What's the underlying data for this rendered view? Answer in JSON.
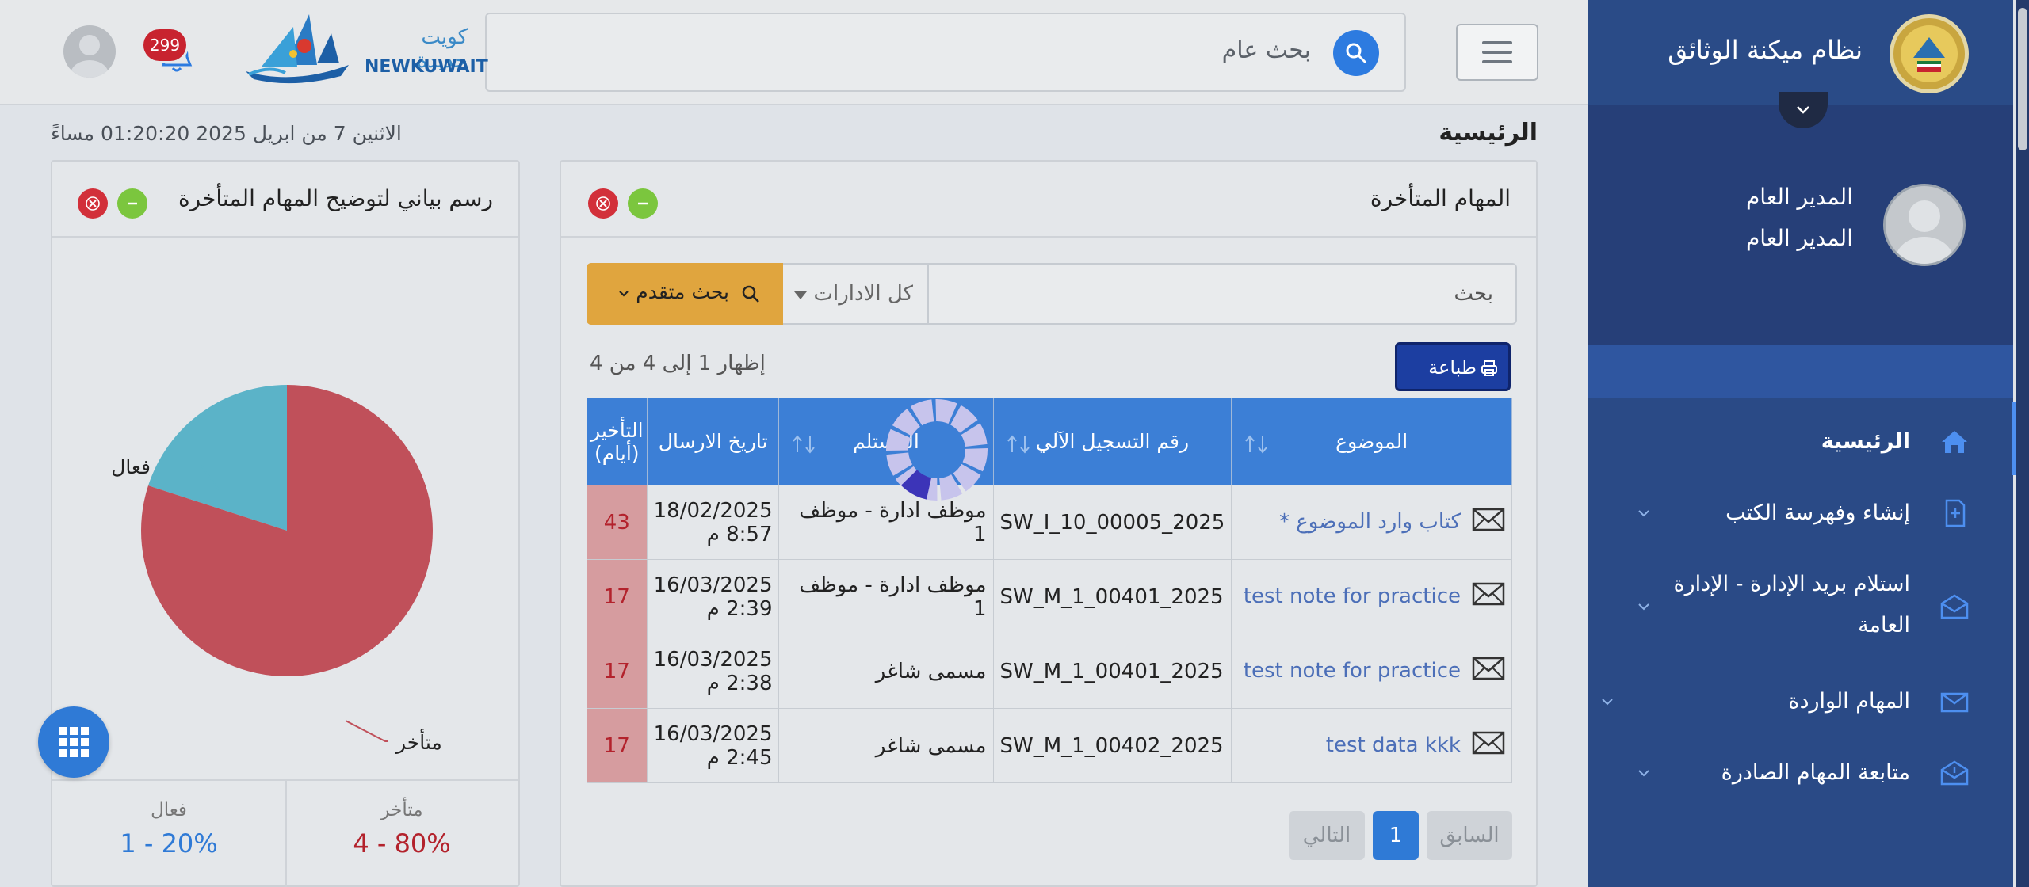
{
  "header": {
    "search_label": "بحث عام",
    "notification_count": "299",
    "logo_ar": "كويت جديدة",
    "logo_en": "NEWKUWAIT"
  },
  "sidebar": {
    "title": "نظام ميكنة الوثائق",
    "user_name": "المدير العام",
    "user_role": "المدير العام",
    "items": [
      {
        "label": "الرئيسية",
        "icon": "home-icon",
        "active": true
      },
      {
        "label": "إنشاء وفهرسة الكتب",
        "icon": "file-plus-icon"
      },
      {
        "label": "استلام بريد الإدارة - الإدارة العامة",
        "icon": "envelope-open-icon"
      },
      {
        "label": "المهام الواردة",
        "icon": "envelope-icon"
      },
      {
        "label": "متابعة المهام الصادرة",
        "icon": "envelope-share-icon"
      }
    ]
  },
  "main": {
    "date_line": "الاثنين 7 من ابريل 2025   01:20:20 مساءً",
    "page_title": "الرئيسية"
  },
  "tasks_panel": {
    "title": "المهام المتأخرة",
    "search_placeholder": "بحث",
    "dept_select": "كل الادارات",
    "advanced_search": "بحث متقدم",
    "print": "طباعة",
    "showing": "إظهار 1 إلى 4 من 4",
    "columns": [
      "الموضوع",
      "رقم التسجيل الآلي",
      "المستلم",
      "تاريخ الارسال",
      "التأخير (أيام)"
    ],
    "rows": [
      {
        "subject": "كتاب وارد الموضوع *",
        "reg_no": "SW_I_10_00005_2025",
        "recipient": "موظف ادارة - موظف 1",
        "sent_date": "18/02/2025",
        "sent_time": "8:57 م",
        "delay": "43"
      },
      {
        "subject": "test note for practice",
        "reg_no": "SW_M_1_00401_2025",
        "recipient": "موظف ادارة - موظف 1",
        "sent_date": "16/03/2025",
        "sent_time": "2:39 م",
        "delay": "17"
      },
      {
        "subject": "test note for practice",
        "reg_no": "SW_M_1_00401_2025",
        "recipient": "مسمى شاغر",
        "sent_date": "16/03/2025",
        "sent_time": "2:38 م",
        "delay": "17"
      },
      {
        "subject": "test data kkk",
        "reg_no": "SW_M_1_00402_2025",
        "recipient": "مسمى شاغر",
        "sent_date": "16/03/2025",
        "sent_time": "2:45 م",
        "delay": "17"
      }
    ],
    "pager": {
      "prev": "السابق",
      "current": "1",
      "next": "التالي"
    }
  },
  "chart_panel": {
    "title": "رسم بياني لتوضيح المهام المتأخرة",
    "late_label": "متأخر",
    "active_label": "فعال",
    "late_value": "4 - 80%",
    "active_value": "1 - 20%"
  },
  "chart_data": {
    "type": "pie",
    "title": "رسم بياني لتوضيح المهام المتأخرة",
    "categories": [
      "متأخر",
      "فعال"
    ],
    "values": [
      4,
      1
    ],
    "percent": [
      80,
      20
    ],
    "colors": [
      "#c0505a",
      "#5bb3c8"
    ]
  },
  "colors": {
    "sidebar": "#2a4a86",
    "accent": "#2f7ad6",
    "late": "#b3222c",
    "active": "#2f7ad6"
  }
}
